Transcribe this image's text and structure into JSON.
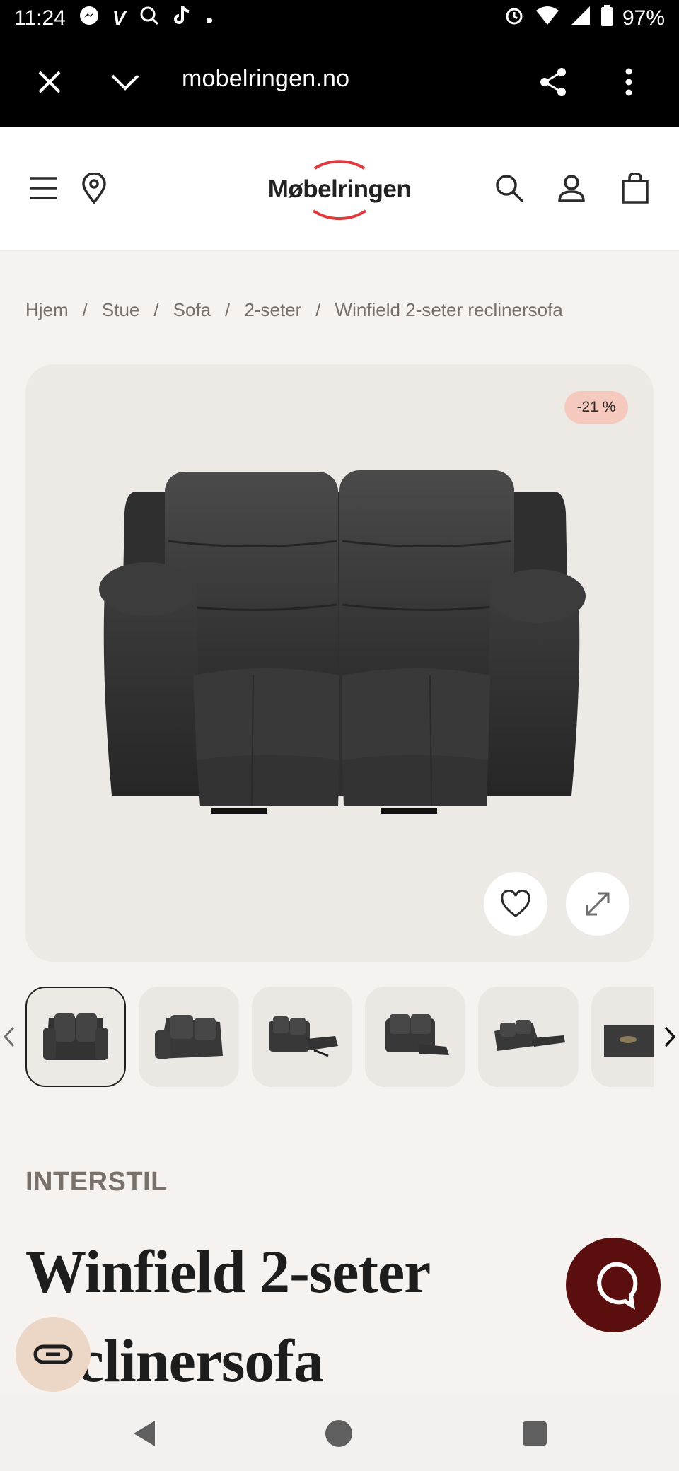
{
  "status_bar": {
    "time": "11:24",
    "battery": "97%",
    "left_icons": [
      "messenger-icon",
      "v-app-icon",
      "search-app-icon",
      "tiktok-icon",
      "dot-icon"
    ],
    "right_icons": [
      "alarm-icon",
      "wifi-icon",
      "signal-icon",
      "battery-icon"
    ]
  },
  "browser": {
    "url": "mobelringen.no",
    "close_icon": "close-icon",
    "collapse_icon": "chevron-down-icon",
    "share_icon": "share-icon",
    "menu_icon": "more-vertical-icon"
  },
  "header": {
    "logo_text": "Møbelringen",
    "logo_accent_color": "#e0393e",
    "icons": [
      "menu-icon",
      "location-pin-icon",
      "search-icon",
      "user-icon",
      "shopping-bag-icon"
    ]
  },
  "breadcrumb": {
    "items": [
      "Hjem",
      "Stue",
      "Sofa",
      "2-seter",
      "Winfield 2-seter reclinersofa"
    ],
    "separator": "/"
  },
  "gallery": {
    "discount_badge": "-21 %",
    "badge_color": "#f5c9bd",
    "wishlist_icon": "heart-icon",
    "expand_icon": "expand-icon",
    "thumbnails_count_visible": 6,
    "active_thumbnail": 0
  },
  "product": {
    "brand": "INTERSTIL",
    "title_line1": "Winfield 2-seter",
    "title_line2": "reclinersofa"
  },
  "floating": {
    "chat_icon": "chat-bubble-icon",
    "chat_color": "#5a0e0e",
    "link_icon": "link-icon"
  },
  "nav": {
    "icons": [
      "back-triangle-icon",
      "home-circle-icon",
      "recents-square-icon"
    ]
  }
}
